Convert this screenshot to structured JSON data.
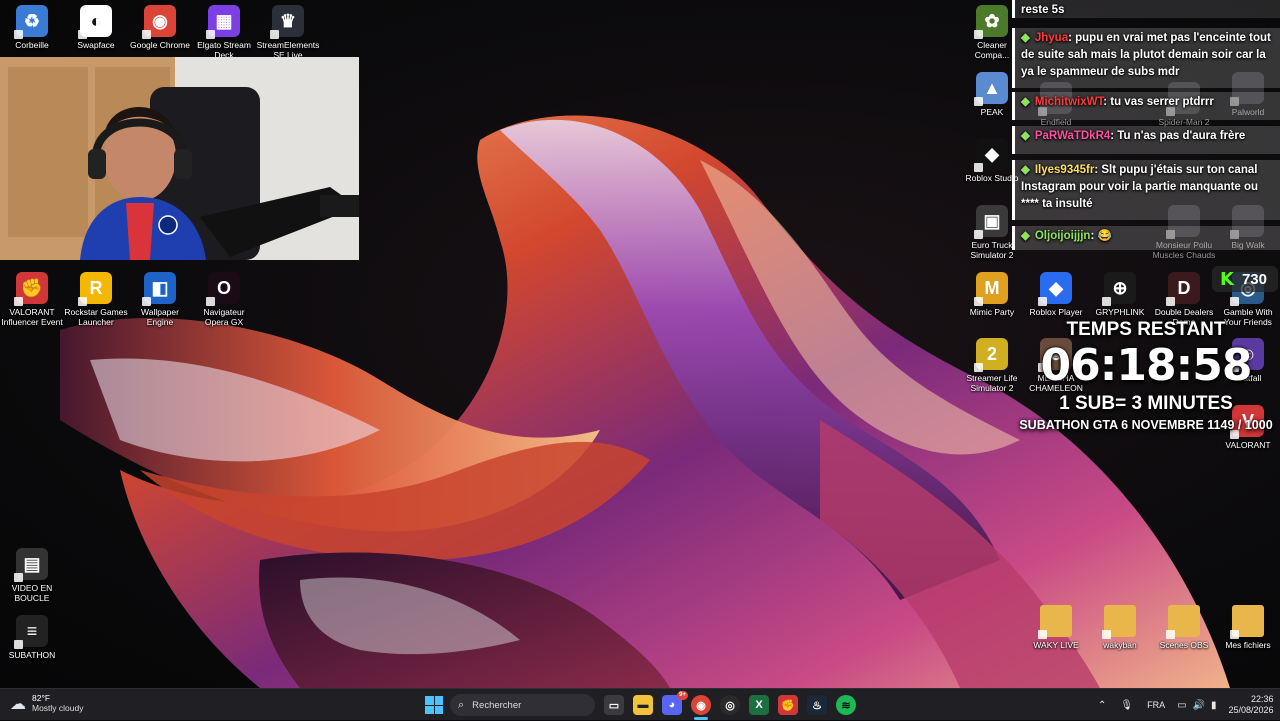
{
  "desktop": {
    "left_icons": [
      {
        "label": "Corbeille",
        "icon": "recycle-bin-icon",
        "color": "#3a7bd5",
        "glyph": "♻"
      },
      {
        "label": "Swapface",
        "icon": "mask-icon",
        "color": "#ffffff",
        "glyph": "◐"
      },
      {
        "label": "Google Chrome",
        "icon": "chrome-icon",
        "color": "#db4437",
        "glyph": "◉"
      },
      {
        "label": "Elgato Stream Deck",
        "icon": "stream-deck-icon",
        "color": "#7b3fe4",
        "glyph": "▦"
      },
      {
        "label": "StreamElements SE.Live",
        "icon": "streamelements-icon",
        "color": "#2b2f3a",
        "glyph": "♛"
      }
    ],
    "row2_icons": [
      {
        "label": "VALORANT Influencer Event",
        "icon": "riot-icon",
        "color": "#d13639",
        "glyph": "✊"
      },
      {
        "label": "Rockstar Games Launcher",
        "icon": "rockstar-icon",
        "color": "#f5b700",
        "glyph": "R"
      },
      {
        "label": "Wallpaper Engine",
        "icon": "wallpaper-engine-icon",
        "color": "#1e63c8",
        "glyph": "◧"
      },
      {
        "label": "Navigateur Opera GX",
        "icon": "opera-gx-icon",
        "color": "#1a0b14",
        "glyph": "O"
      }
    ],
    "bottom_left_icons": [
      {
        "label": "VIDEO EN BOUCLE",
        "icon": "video-file-icon",
        "color": "#333333",
        "glyph": "▤"
      },
      {
        "label": "SUBATHON",
        "icon": "text-file-icon",
        "color": "#222222",
        "glyph": "≡"
      }
    ],
    "right_icons": [
      {
        "label": "Cleaner Compa...",
        "icon": "cleaner-icon",
        "color": "#4a7a2a",
        "glyph": "✿"
      },
      {
        "label": "PEAK",
        "icon": "peak-icon",
        "color": "#5a8bd0",
        "glyph": "▲"
      },
      {
        "label": "Roblox Studio",
        "icon": "roblox-studio-icon",
        "color": "#111111",
        "glyph": "◆"
      },
      {
        "label": "Euro Truck Simulator 2",
        "icon": "truck-icon",
        "color": "#3a3a3a",
        "glyph": "▣"
      },
      {
        "label": "Mimic Party",
        "icon": "mimic-party-icon",
        "color": "#e0a020",
        "glyph": "M"
      },
      {
        "label": "Roblox Player",
        "icon": "roblox-icon",
        "color": "#2a6cf0",
        "glyph": "◆"
      },
      {
        "label": "GRYPHLINK",
        "icon": "gryphlink-icon",
        "color": "#1a1a1a",
        "glyph": "⊕"
      },
      {
        "label": "Double Dealers Demo",
        "icon": "double-dealers-icon",
        "color": "#3a1a1a",
        "glyph": "D"
      },
      {
        "label": "Gamble With Your Friends",
        "icon": "gamble-icon",
        "color": "#2a5a8a",
        "glyph": "◎"
      },
      {
        "label": "Streamer Life Simulator 2",
        "icon": "streamer-life-icon",
        "color": "#d0b020",
        "glyph": "2"
      },
      {
        "label": "MECCHA CHAMELEON",
        "icon": "chameleon-icon",
        "color": "#6a4a3a",
        "glyph": "☻"
      },
      {
        "label": "Pratfall",
        "icon": "pratfall-icon",
        "color": "#5a3aa0",
        "glyph": "☺"
      },
      {
        "label": "VALORANT",
        "icon": "valorant-icon",
        "color": "#d13639",
        "glyph": "V"
      }
    ],
    "faded_icons": [
      {
        "label": "Endfield",
        "icon": "endfield-icon"
      },
      {
        "label": "Spider-Man 2",
        "icon": "spiderman-icon"
      },
      {
        "label": "Palworld",
        "icon": "palworld-icon"
      },
      {
        "label": "Monsieur Poilu Muscles Chauds",
        "icon": "monsieur-poilu-icon"
      },
      {
        "label": "Big Walk",
        "icon": "big-walk-icon"
      }
    ],
    "folders": [
      {
        "label": "WAKY LIVE",
        "icon": "folder-icon"
      },
      {
        "label": "wakyban",
        "icon": "folder-icon"
      },
      {
        "label": "Scenes OBS",
        "icon": "folder-icon"
      },
      {
        "label": "Mes fichiers",
        "icon": "folder-icon"
      }
    ]
  },
  "chat": {
    "top_line": "reste 5s",
    "messages": [
      {
        "user": "Jhyua",
        "user_color": "#ff3b3b",
        "text": ": pupu en vrai met pas l'enceinte tout de suite sah mais la plutot demain soir car la ya le spammeur de subs mdr"
      },
      {
        "user": "MichitwixWT",
        "user_color": "#ff3b3b",
        "text": ": tu vas serrer ptdrrr"
      },
      {
        "user": "PaRWaTDkR4",
        "user_color": "#ff4fa0",
        "text": ": Tu n'as pas d'aura frère"
      },
      {
        "user": "Ilyes9345fr",
        "user_color": "#ffe066",
        "text": ": Slt pupu j'étais sur ton canal Instagram pour voir la partie manquante ou **** ta insulté"
      },
      {
        "user": "Oljoijoijjjn",
        "user_color": "#8fe35a",
        "text": ": 😂"
      }
    ],
    "kick_count": "730"
  },
  "timer": {
    "heading": "TEMPS RESTANT",
    "time": "06:18:58",
    "rate": "1 SUB= 3 MINUTES",
    "goal": "SUBATHON GTA 6 NOVEMBRE 1149 / 1000"
  },
  "taskbar": {
    "weather_temp": "82°F",
    "weather_desc": "Mostly cloudy",
    "search_placeholder": "Rechercher",
    "discord_badge": "9+",
    "language": "FRA",
    "time": "22:36",
    "date": "25/08/2026"
  }
}
